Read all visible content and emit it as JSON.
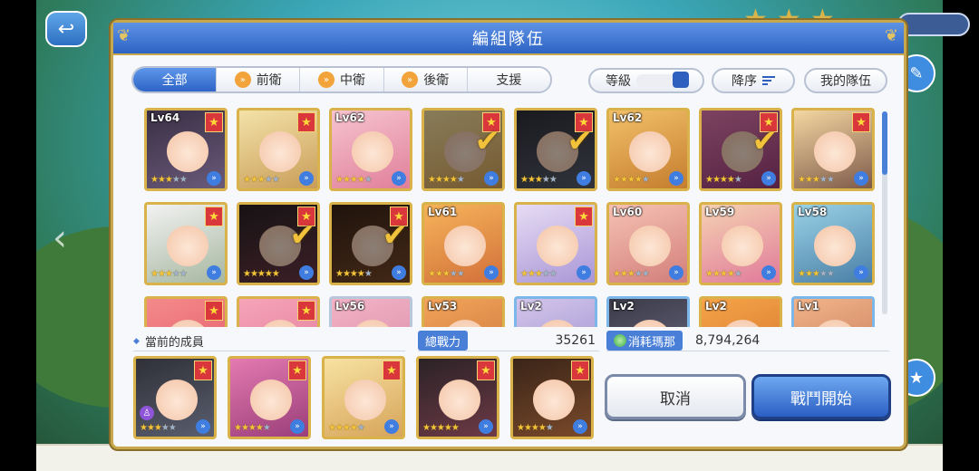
{
  "dialog": {
    "title": "編組隊伍"
  },
  "tabs": [
    {
      "label": "全部",
      "active": true,
      "icon": ""
    },
    {
      "label": "前衛",
      "active": false,
      "icon": "double-chevron-icon"
    },
    {
      "label": "中衛",
      "active": false,
      "icon": "double-chevron-icon"
    },
    {
      "label": "後衛",
      "active": false,
      "icon": "double-chevron-icon"
    },
    {
      "label": "支援",
      "active": false,
      "icon": ""
    }
  ],
  "sort": {
    "level_label": "等級",
    "order_label": "降序",
    "my_team_label": "我的隊伍"
  },
  "roster": [
    {
      "level": "Lv64",
      "rarity": true,
      "stars": 3,
      "selected": false,
      "check": false,
      "frame": "gold",
      "c1": "#3a2f45",
      "c2": "#6a5a7a"
    },
    {
      "level": "",
      "rarity": true,
      "stars": 3,
      "selected": false,
      "check": false,
      "frame": "gold",
      "c1": "#f3e2a8",
      "c2": "#c99d58"
    },
    {
      "level": "Lv62",
      "rarity": false,
      "stars": 4,
      "selected": false,
      "check": false,
      "frame": "gold",
      "c1": "#f6c4cf",
      "c2": "#e07f99"
    },
    {
      "level": "",
      "rarity": true,
      "stars": 4,
      "selected": true,
      "check": true,
      "frame": "gold",
      "c1": "#f7e2a2",
      "c2": "#d7a45a"
    },
    {
      "level": "",
      "rarity": true,
      "stars": 3,
      "selected": true,
      "check": true,
      "frame": "gold",
      "c1": "#2f3038",
      "c2": "#5a5e6e"
    },
    {
      "level": "Lv62",
      "rarity": false,
      "stars": 4,
      "selected": false,
      "check": false,
      "frame": "gold",
      "c1": "#f3c06a",
      "c2": "#c47d2e"
    },
    {
      "level": "",
      "rarity": true,
      "stars": 4,
      "selected": true,
      "check": true,
      "frame": "gold",
      "c1": "#e47ab0",
      "c2": "#9a3e7a"
    },
    {
      "level": "",
      "rarity": true,
      "stars": 3,
      "selected": false,
      "check": false,
      "frame": "gold",
      "c1": "#f4d7a1",
      "c2": "#7e5a4a"
    },
    {
      "level": "",
      "rarity": true,
      "stars": 3,
      "selected": false,
      "check": false,
      "frame": "gold",
      "c1": "#f2f2f2",
      "c2": "#a6b7a0"
    },
    {
      "level": "",
      "rarity": true,
      "stars": 5,
      "selected": true,
      "check": true,
      "frame": "gold",
      "c1": "#2a2226",
      "c2": "#6e3a46"
    },
    {
      "level": "",
      "rarity": true,
      "stars": 4,
      "selected": true,
      "check": true,
      "frame": "gold",
      "c1": "#3a2418",
      "c2": "#7a4a2a"
    },
    {
      "level": "Lv61",
      "rarity": false,
      "stars": 3,
      "selected": false,
      "check": false,
      "frame": "gold",
      "c1": "#f6b45a",
      "c2": "#d2703a"
    },
    {
      "level": "",
      "rarity": true,
      "stars": 3,
      "selected": false,
      "check": false,
      "frame": "gold",
      "c1": "#e6dcf4",
      "c2": "#a996d6"
    },
    {
      "level": "Lv60",
      "rarity": false,
      "stars": 3,
      "selected": false,
      "check": false,
      "frame": "gold",
      "c1": "#f6c2b4",
      "c2": "#d27e7a"
    },
    {
      "level": "Lv59",
      "rarity": false,
      "stars": 4,
      "selected": false,
      "check": false,
      "frame": "gold",
      "c1": "#f5d2b2",
      "c2": "#e07a9a"
    },
    {
      "level": "Lv58",
      "rarity": false,
      "stars": 3,
      "selected": false,
      "check": false,
      "frame": "gold",
      "c1": "#9ad2e6",
      "c2": "#4a7ea6"
    },
    {
      "level": "",
      "rarity": true,
      "stars": 0,
      "selected": false,
      "check": false,
      "frame": "gold",
      "c1": "#f48a8a",
      "c2": "#e25a6a"
    },
    {
      "level": "",
      "rarity": true,
      "stars": 0,
      "selected": false,
      "check": false,
      "frame": "gold",
      "c1": "#f6a4b8",
      "c2": "#e07a9a"
    },
    {
      "level": "Lv56",
      "rarity": false,
      "stars": 0,
      "selected": false,
      "check": false,
      "frame": "silver",
      "c1": "#f2b4c6",
      "c2": "#d98aa6"
    },
    {
      "level": "Lv53",
      "rarity": false,
      "stars": 0,
      "selected": false,
      "check": false,
      "frame": "gold",
      "c1": "#f3a45a",
      "c2": "#c8743a"
    },
    {
      "level": "Lv2",
      "rarity": false,
      "stars": 0,
      "selected": false,
      "check": false,
      "frame": "blue",
      "c1": "#d4c6ea",
      "c2": "#9a8ed0"
    },
    {
      "level": "Lv2",
      "rarity": false,
      "stars": 0,
      "selected": false,
      "check": false,
      "frame": "blue",
      "c1": "#3a3a48",
      "c2": "#6a6a82"
    },
    {
      "level": "Lv2",
      "rarity": false,
      "stars": 0,
      "selected": false,
      "check": false,
      "frame": "gold",
      "c1": "#f6a44a",
      "c2": "#d2742a"
    },
    {
      "level": "Lv1",
      "rarity": false,
      "stars": 0,
      "selected": false,
      "check": false,
      "frame": "blue",
      "c1": "#f2b48a",
      "c2": "#c47a5a"
    }
  ],
  "team_section": {
    "label": "當前的成員",
    "power_label": "總戰力",
    "power_value": "35261",
    "mana_label": "消耗瑪那",
    "mana_value": "8,794,264"
  },
  "team": [
    {
      "stars": 3,
      "special": true,
      "c1": "#2f3038",
      "c2": "#5a5e6e"
    },
    {
      "stars": 4,
      "special": false,
      "c1": "#e47ab0",
      "c2": "#9a3e7a"
    },
    {
      "stars": 4,
      "special": false,
      "c1": "#f7e2a2",
      "c2": "#d7a45a"
    },
    {
      "stars": 5,
      "special": false,
      "c1": "#2a2226",
      "c2": "#6e3a46"
    },
    {
      "stars": 4,
      "special": false,
      "c1": "#3a2418",
      "c2": "#7a4a2a"
    }
  ],
  "buttons": {
    "cancel": "取消",
    "start": "戰鬥開始"
  }
}
